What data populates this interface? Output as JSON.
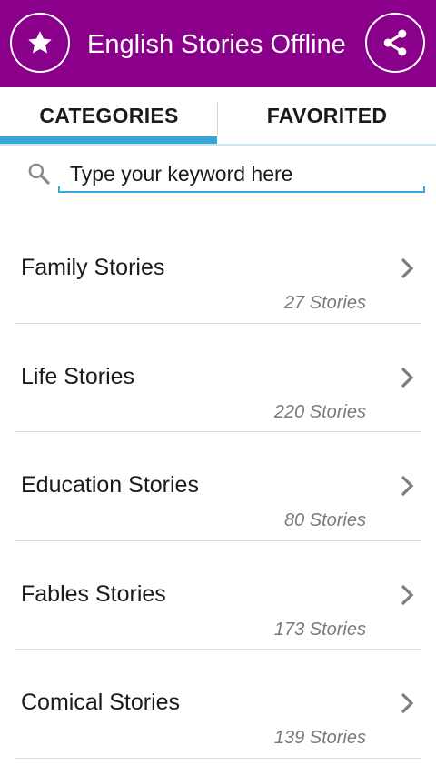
{
  "app_bar": {
    "title": "English Stories Offline",
    "background_color": "#8a008a",
    "left_icon": "star-icon",
    "right_icon": "share-icon"
  },
  "tabs": [
    {
      "label": "CATEGORIES",
      "selected": true
    },
    {
      "label": "FAVORITED",
      "selected": false
    }
  ],
  "accent_color": "#3aa6d8",
  "search": {
    "placeholder": "Type your keyword here",
    "value": "",
    "icon": "search-icon"
  },
  "categories": [
    {
      "name": "Family Stories",
      "count": "27 Stories"
    },
    {
      "name": "Life Stories",
      "count": "220 Stories"
    },
    {
      "name": "Education Stories",
      "count": "80 Stories"
    },
    {
      "name": "Fables Stories",
      "count": "173 Stories"
    },
    {
      "name": "Comical Stories",
      "count": "139 Stories"
    }
  ]
}
